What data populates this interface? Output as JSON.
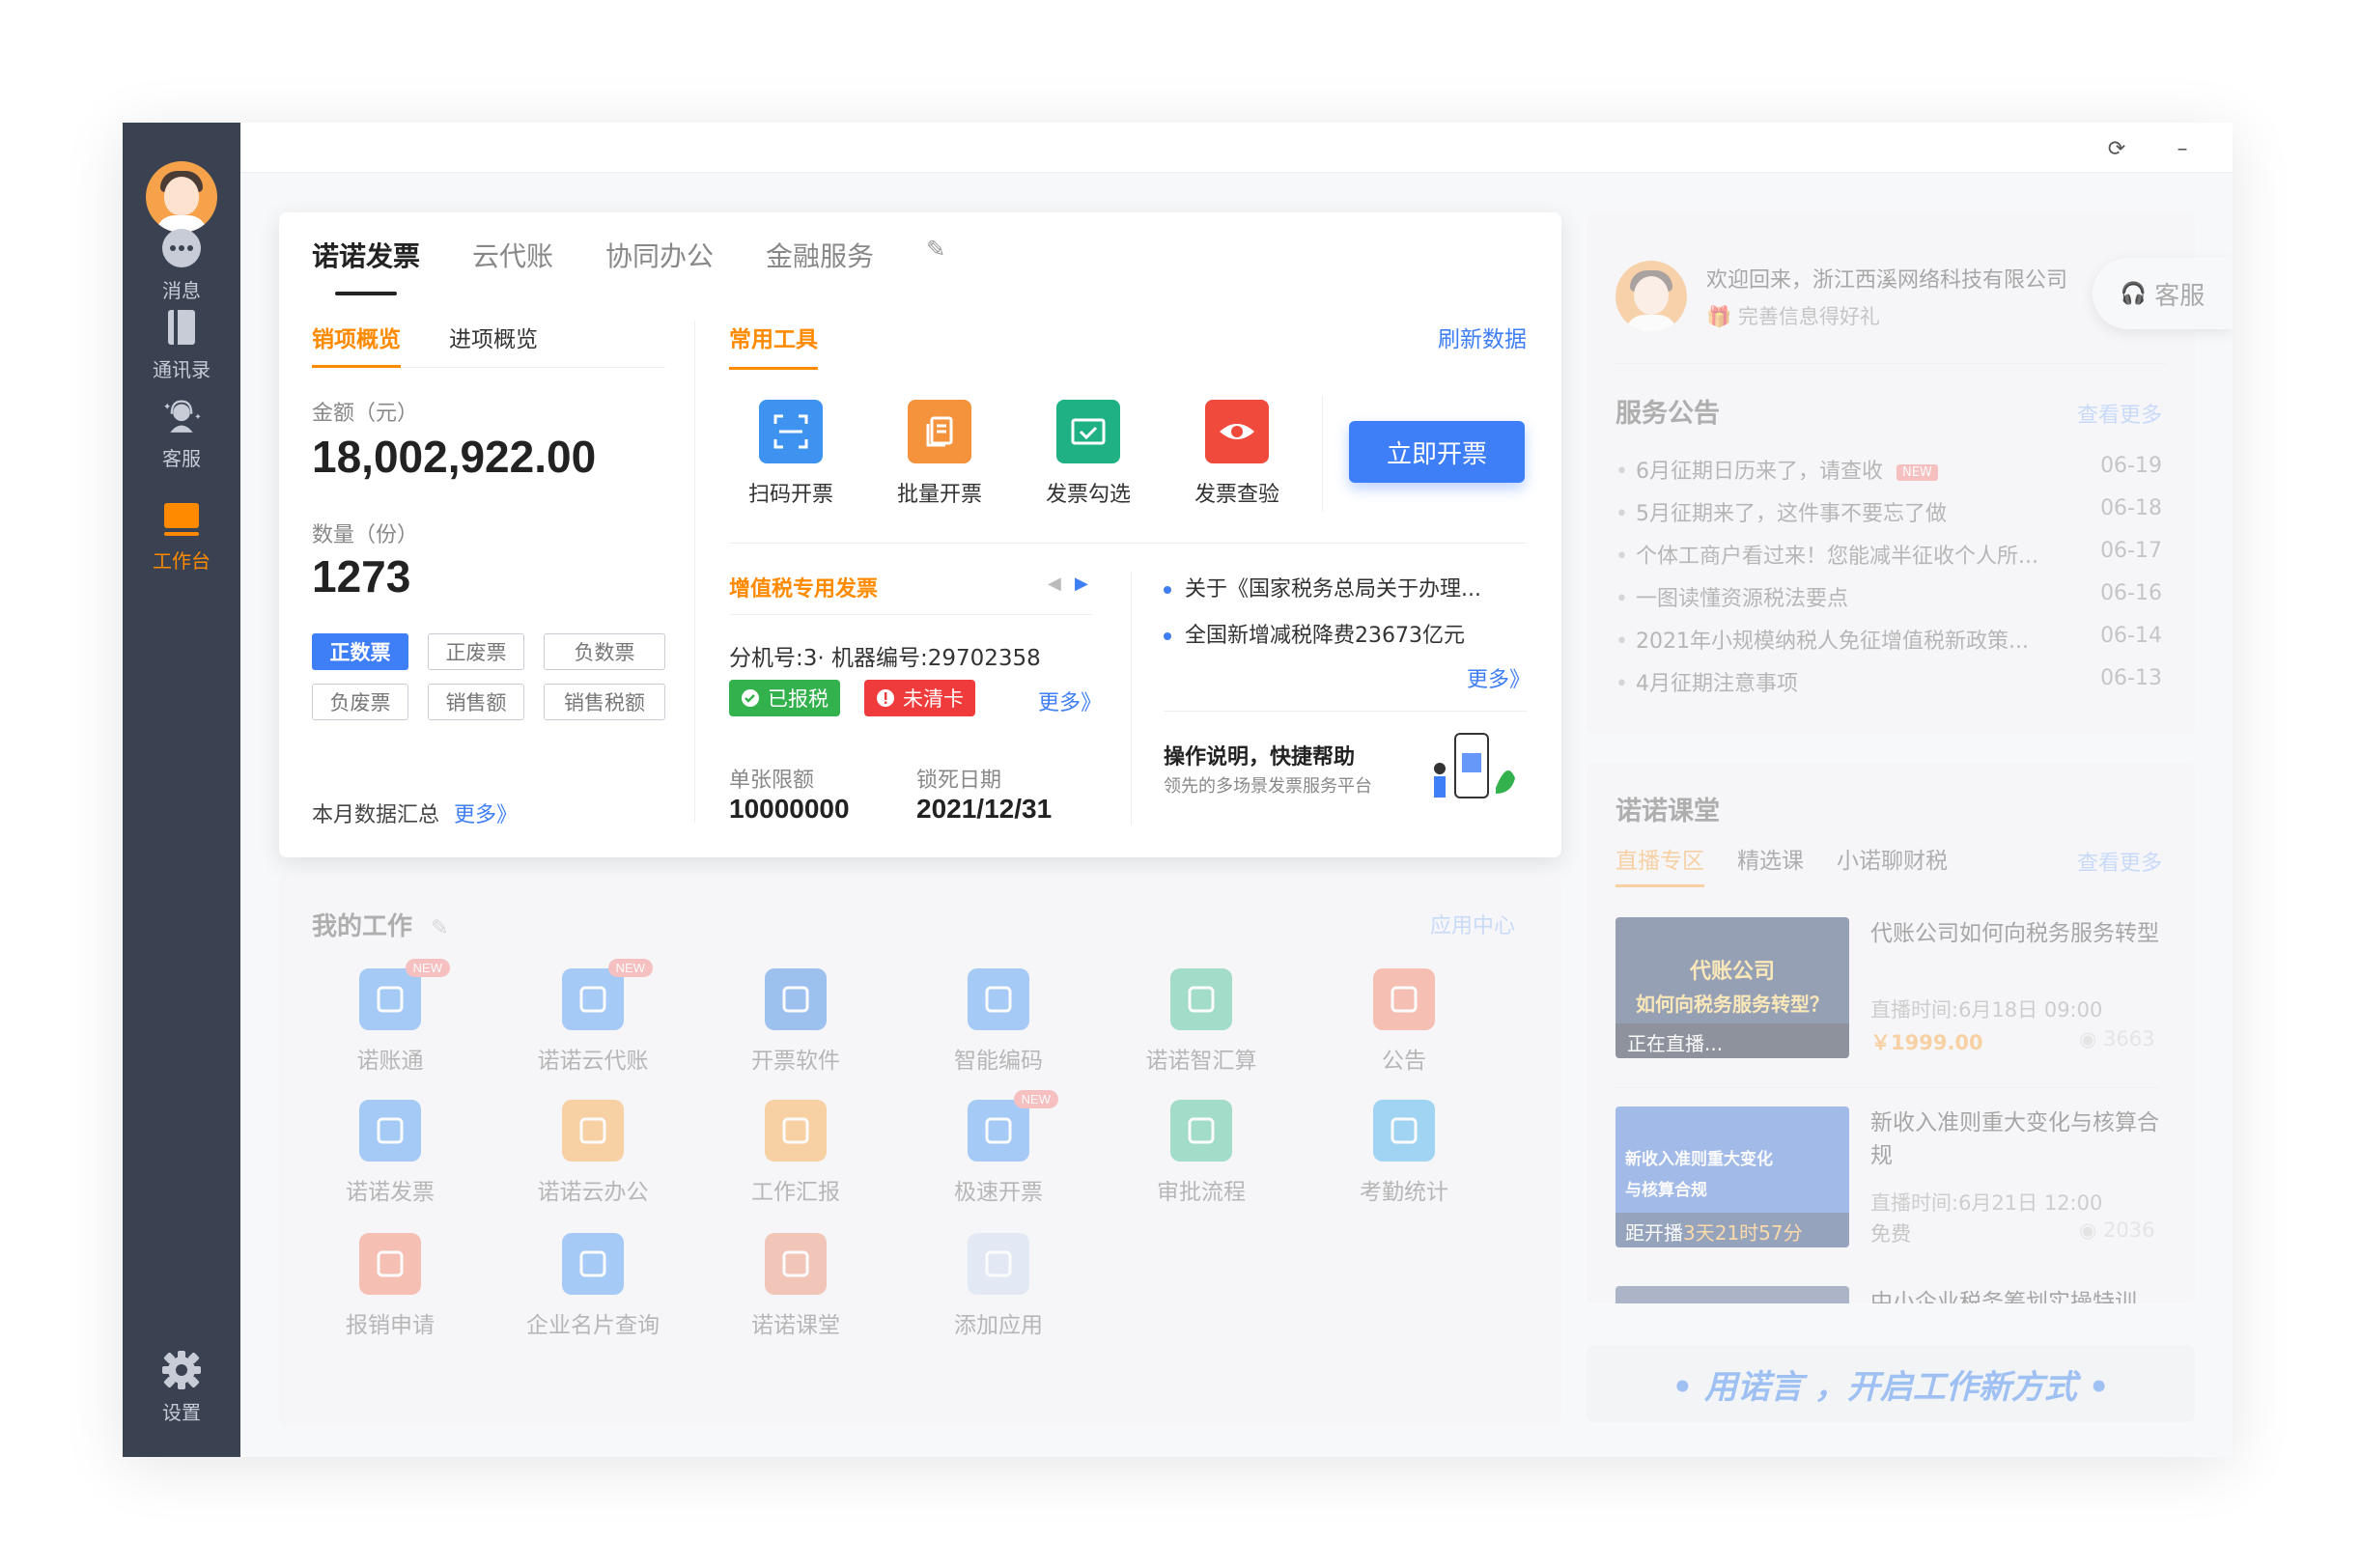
{
  "sidebar": {
    "items": [
      {
        "label": "消息",
        "icon": "message-icon"
      },
      {
        "label": "通讯录",
        "icon": "contacts-icon"
      },
      {
        "label": "客服",
        "icon": "support-icon"
      },
      {
        "label": "工作台",
        "icon": "workbench-icon"
      },
      {
        "label": "设置",
        "icon": "settings-icon"
      }
    ]
  },
  "main_tabs": [
    "诺诺发票",
    "云代账",
    "协同办公",
    "金融服务"
  ],
  "overview": {
    "sub_tabs": [
      "销项概览",
      "进项概览"
    ],
    "amount_label": "金额（元）",
    "amount_value": "18,002,922.00",
    "count_label": "数量（份）",
    "count_value": "1273",
    "tags": [
      "正数票",
      "正废票",
      "负数票",
      "负废票",
      "销售额",
      "销售税额"
    ],
    "summary_label": "本月数据汇总",
    "more": "更多》"
  },
  "tools": {
    "title": "常用工具",
    "refresh": "刷新数据",
    "items": [
      "扫码开票",
      "批量开票",
      "发票勾选",
      "发票查验"
    ],
    "primary_button": "立即开票"
  },
  "invoice": {
    "title": "增值税专用发票",
    "machine": "分机号:3· 机器编号:29702358",
    "status_reported": "已报税",
    "status_uncleared": "未清卡",
    "more": "更多》",
    "limit_label": "单张限额",
    "limit_value": "10000000",
    "lock_label": "锁死日期",
    "lock_value": "2021/12/31"
  },
  "news": {
    "items": [
      "关于《国家税务总局关于办理...",
      "全国新增减税降费23673亿元"
    ],
    "more": "更多》",
    "help_title": "操作说明，快捷帮助",
    "help_sub": "领先的多场景发票服务平台"
  },
  "my_work": {
    "title": "我的工作",
    "app_center": "应用中心",
    "apps": [
      {
        "label": "诺账通",
        "new": true,
        "color": "#3e93f0"
      },
      {
        "label": "诺诺云代账",
        "new": true,
        "color": "#3e93f0"
      },
      {
        "label": "开票软件",
        "new": false,
        "color": "#2f7ee3"
      },
      {
        "label": "智能编码",
        "new": false,
        "color": "#3e93f0"
      },
      {
        "label": "诺诺智汇算",
        "new": false,
        "color": "#3dbb8f"
      },
      {
        "label": "公告",
        "new": false,
        "color": "#f27a5e"
      },
      {
        "label": "诺诺发票",
        "new": false,
        "color": "#3e93f0"
      },
      {
        "label": "诺诺云办公",
        "new": false,
        "color": "#f5a03c"
      },
      {
        "label": "工作汇报",
        "new": false,
        "color": "#f5a03c"
      },
      {
        "label": "极速开票",
        "new": true,
        "color": "#3e93f0"
      },
      {
        "label": "审批流程",
        "new": false,
        "color": "#3dbb8f"
      },
      {
        "label": "考勤统计",
        "new": false,
        "color": "#38a8e8"
      },
      {
        "label": "报销申请",
        "new": false,
        "color": "#f27a5e"
      },
      {
        "label": "企业名片查询",
        "new": false,
        "color": "#3e93f0"
      },
      {
        "label": "诺诺课堂",
        "new": false,
        "color": "#e88a6a"
      },
      {
        "label": "添加应用",
        "new": false,
        "color": "#c9d8ee"
      }
    ]
  },
  "user": {
    "welcome": "欢迎回来，浙江西溪网络科技有限公司",
    "gift": "完善信息得好礼",
    "service": "客服"
  },
  "notices": {
    "title": "服务公告",
    "more": "查看更多",
    "items": [
      {
        "text": "6月征期日历来了，请查收",
        "date": "06-19",
        "new": true
      },
      {
        "text": "5月征期来了，这件事不要忘了做",
        "date": "06-18",
        "new": false
      },
      {
        "text": "个体工商户看过来！您能减半征收个人所...",
        "date": "06-17",
        "new": false
      },
      {
        "text": "一图读懂资源税法要点",
        "date": "06-16",
        "new": false
      },
      {
        "text": "2021年小规模纳税人免征增值税新政策...",
        "date": "06-14",
        "new": false
      },
      {
        "text": "4月征期注意事项",
        "date": "06-13",
        "new": false
      }
    ],
    "new_label": "NEW"
  },
  "classroom": {
    "title": "诺诺课堂",
    "tabs": [
      "直播专区",
      "精选课",
      "小诺聊财税"
    ],
    "more": "查看更多",
    "courses": [
      {
        "title": "代账公司如何向税务服务转型",
        "time": "直播时间:6月18日 09:00",
        "price": "￥1999.00",
        "views": "3663",
        "thumb_badge": "正在直播...",
        "thumb_title1": "代账公司",
        "thumb_title2": "如何向税务服务转型？"
      },
      {
        "title": "新收入准则重大变化与核算合规",
        "time": "直播时间:6月21日 12:00",
        "price": "免费",
        "views": "2036",
        "thumb_badge_prefix": "距开播",
        "thumb_badge": "3天21时57分",
        "thumb_title1": "新收入准则重大变化",
        "thumb_title2": "与核算合规"
      },
      {
        "title": "中小企业税务筹划实操特训"
      }
    ]
  },
  "slogan": "• 用诺言 ，开启工作新方式 •",
  "colors": {
    "accent": "#3e7ef6",
    "orange": "#ff8a00",
    "sidebar": "#3a4252"
  }
}
